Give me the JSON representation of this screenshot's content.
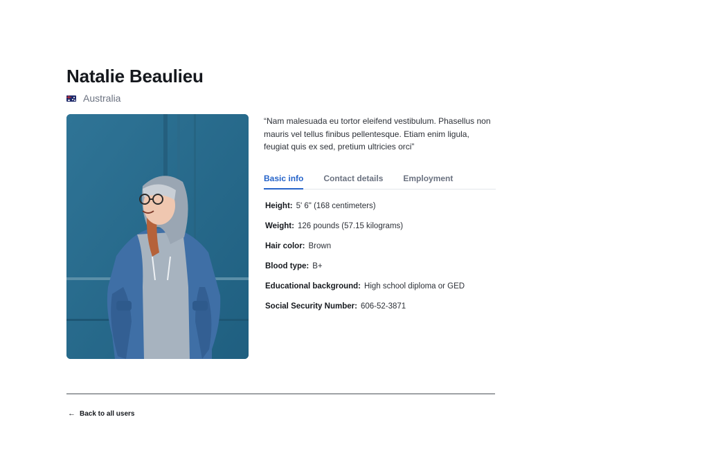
{
  "user": {
    "name": "Natalie Beaulieu",
    "country": "Australia",
    "country_flag_icon": "australia-flag-icon",
    "photo_icon": "profile-photo",
    "quote": "“Nam malesuada eu tortor eleifend vestibulum. Phasellus non mauris vel tellus finibus pellentesque. Etiam enim ligula, feugiat quis ex sed, pretium ultricies orci”"
  },
  "tabs": [
    {
      "label": "Basic info",
      "active": true
    },
    {
      "label": "Contact details",
      "active": false
    },
    {
      "label": "Employment",
      "active": false
    }
  ],
  "basic_info": [
    {
      "label": "Height:",
      "value": "5' 6\" (168 centimeters)"
    },
    {
      "label": "Weight:",
      "value": "126 pounds (57.15 kilograms)"
    },
    {
      "label": "Hair color:",
      "value": "Brown"
    },
    {
      "label": "Blood type:",
      "value": "B+"
    },
    {
      "label": "Educational background:",
      "value": "High school diploma or GED"
    },
    {
      "label": "Social Security Number:",
      "value": "606-52-3871"
    }
  ],
  "footer": {
    "back_label": "Back to all users",
    "back_icon": "arrow-left-icon"
  },
  "colors": {
    "accent": "#2563c9",
    "text": "#15181d",
    "muted": "#6b7280",
    "photo_wall": "#2a6c8c"
  }
}
